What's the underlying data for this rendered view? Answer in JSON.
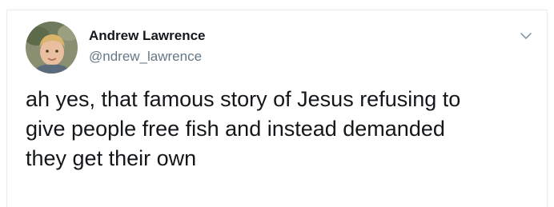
{
  "author": {
    "display_name": "Andrew Lawrence",
    "handle": "@ndrew_lawrence",
    "avatar_icon": "profile-photo-avatar"
  },
  "menu": {
    "icon": "chevron-down-icon"
  },
  "tweet": {
    "text": "ah yes, that famous story of Jesus refusing to\ngive people free fish and instead demanded\nthey get their own"
  },
  "colors": {
    "name": "#14171a",
    "handle": "#657786",
    "caret": "#8899a6",
    "border": "#e6ecf0"
  }
}
